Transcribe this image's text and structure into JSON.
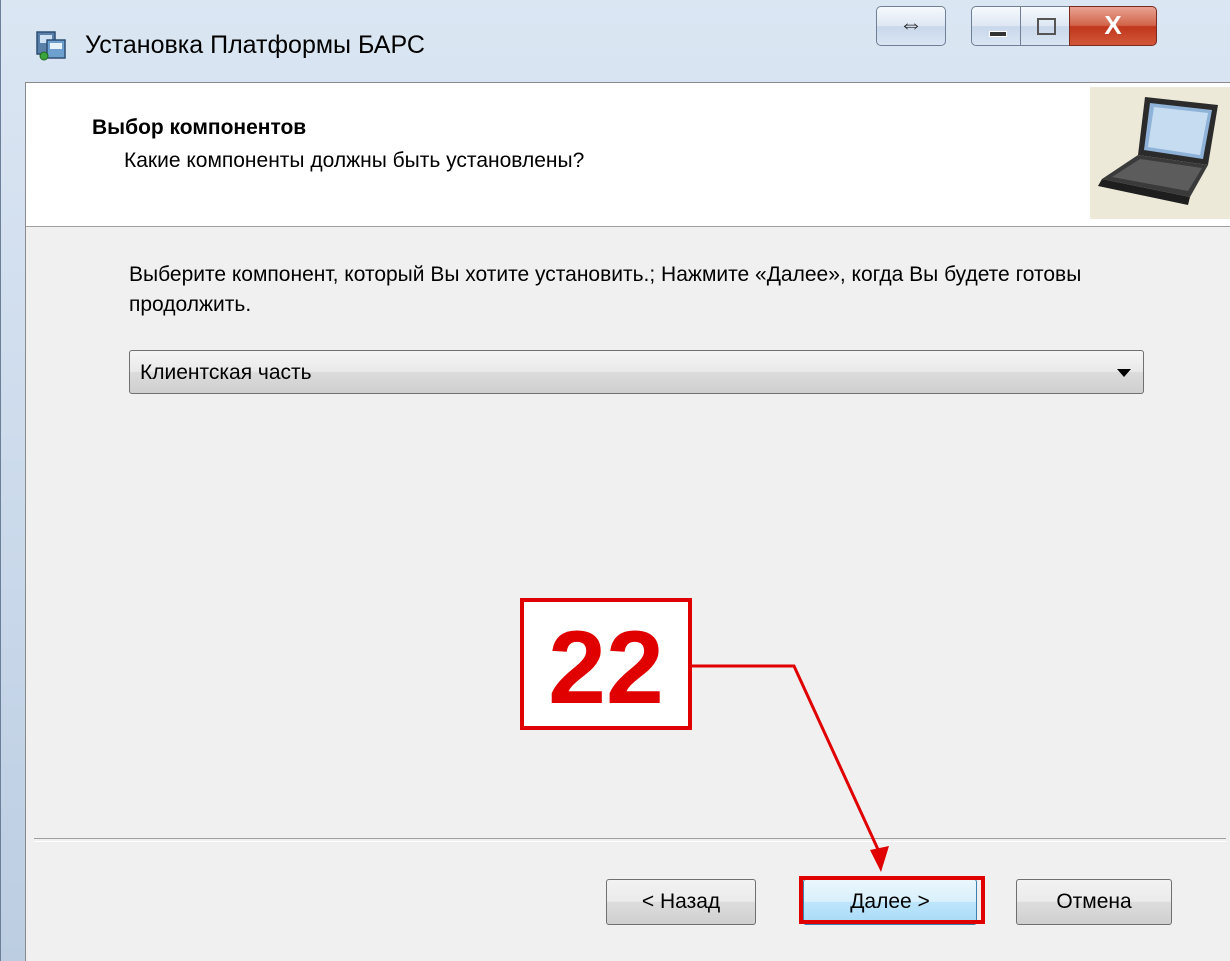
{
  "window": {
    "title": "Установка Платформы БАРС",
    "close_glyph": "X",
    "resize_glyph": "⇔"
  },
  "header": {
    "title": "Выбор компонентов",
    "subtitle": "Какие компоненты должны быть установлены?",
    "image_icon": "laptop-icon"
  },
  "main": {
    "instructions": "Выберите компонент, который Вы хотите установить.; Нажмите «Далее», когда Вы будете готовы продолжить.",
    "component_select": {
      "value": "Клиентская часть"
    }
  },
  "footer": {
    "back_label": "< Назад",
    "next_label": "Далее >",
    "cancel_label": "Отмена"
  },
  "annotation": {
    "step_number": "22",
    "color": "#e00000"
  }
}
